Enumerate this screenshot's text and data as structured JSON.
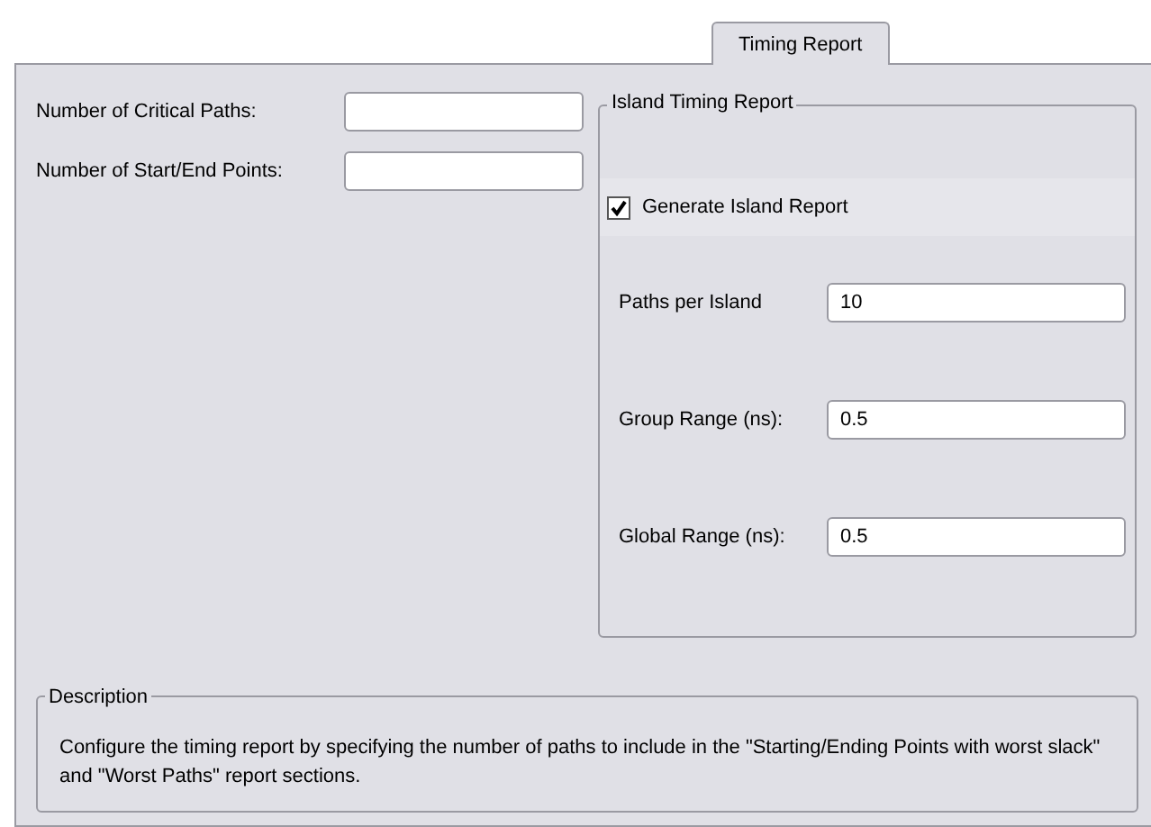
{
  "tabs": [
    {
      "label": "Timing Report",
      "selected": true
    }
  ],
  "fields": [
    {
      "label": "Number of Critical Paths:"
    },
    {
      "label": "Number of Start/End Points:"
    }
  ],
  "island_group": {
    "title": "Island Timing Report",
    "checkbox": {
      "label": "Generate Island Report",
      "checked": true
    },
    "fields": [
      {
        "label": "Paths per Island",
        "value": "10"
      },
      {
        "label": "Group Range (ns):",
        "value": "0.5"
      },
      {
        "label": "Global Range (ns):",
        "value": "0.5"
      }
    ]
  },
  "description": {
    "title": "Description",
    "text": "Configure the timing report by specifying the number of paths to include in the \"Starting/Ending Points with worst slack\" and \"Worst Paths\" report sections."
  }
}
